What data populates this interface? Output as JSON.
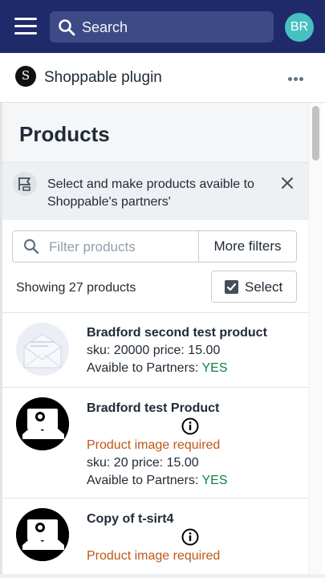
{
  "topbar": {
    "search_placeholder": "Search",
    "avatar_initials": "BR",
    "colors": {
      "bar": "#1f2a6b",
      "avatar": "#47c1bf"
    }
  },
  "app": {
    "logo_letter": "S",
    "title": "Shoppable plugin"
  },
  "page": {
    "title": "Products",
    "banner_text": "Select and make products avaible to Shoppable's partners'",
    "filter_placeholder": "Filter products",
    "more_filters_label": "More filters",
    "showing_text": "Showing 27 products",
    "select_label": "Select"
  },
  "products": [
    {
      "name": "Bradford second test product",
      "sku_price": "sku: 20000 price: 15.00",
      "partners_label": "Avaible to Partners:",
      "partners_value": "YES",
      "image": "envelope-placeholder"
    },
    {
      "name": "Bradford test Product",
      "warning": "Product image required",
      "sku_price": "sku: 20 price: 15.00",
      "partners_label": "Avaible to Partners:",
      "partners_value": "YES",
      "image": "image-missing-icon"
    },
    {
      "name": "Copy of t-sirt4",
      "warning": "Product image required",
      "image": "image-missing-icon"
    }
  ]
}
